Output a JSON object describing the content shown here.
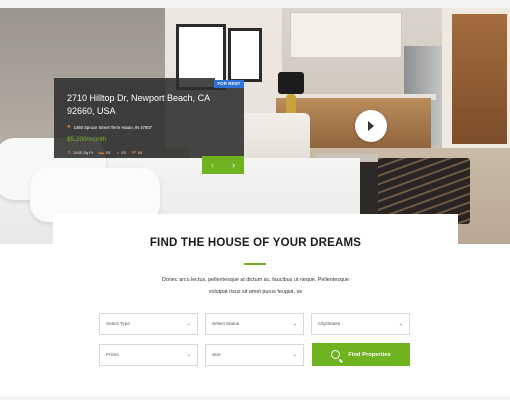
{
  "listing": {
    "badge": "FOR RENT",
    "address": "2710 Hilltop Dr, Newport Beach, CA 92660, USA",
    "location": "1460 Spruce Street Terre Haute, IN 47807",
    "price": "$5,200/month",
    "features": [
      {
        "icon": "area-icon",
        "label": "2400 Sq Ft"
      },
      {
        "icon": "bed-icon",
        "label": "03"
      },
      {
        "icon": "bath-icon",
        "label": "03"
      },
      {
        "icon": "garage-icon",
        "label": "04"
      }
    ],
    "nav": {
      "prev": "‹",
      "next": "›"
    }
  },
  "search": {
    "heading": "FIND THE HOUSE OF YOUR DREAMS",
    "description_line1": "Donec arcu lectus, pellentesque at dictum ac, faucibus ut neque. Pellentesque",
    "description_line2": "volutpat risus sit amet purus feugiat, se",
    "fields": {
      "type": "Select Type",
      "status": "Select Status",
      "city": "City/States",
      "prices": "Prices",
      "size": "Size"
    },
    "button": "Find Properties"
  },
  "colors": {
    "accent": "#6fb320",
    "badge": "#2f6fd6",
    "card_bg": "#2d2d2d"
  }
}
